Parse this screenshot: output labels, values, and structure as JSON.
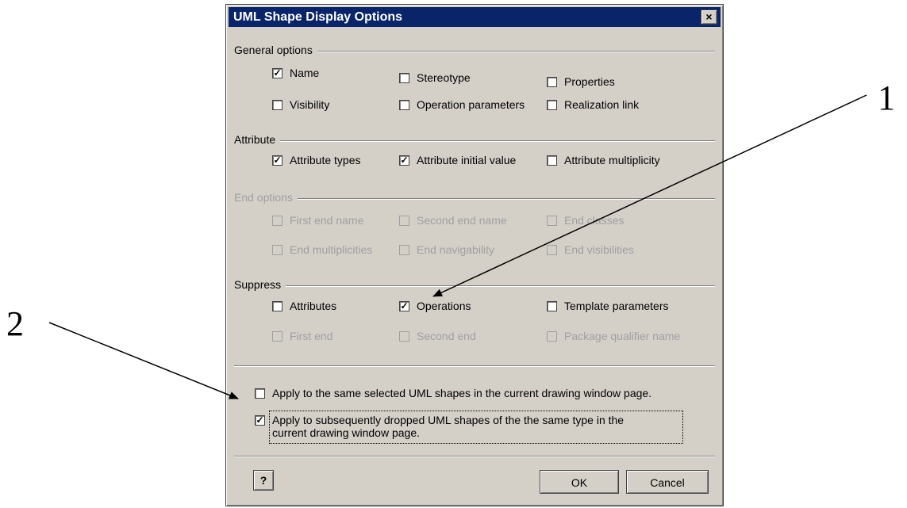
{
  "dialog": {
    "title": "UML Shape Display Options",
    "close_glyph": "×"
  },
  "general": {
    "title": "General options",
    "items": [
      {
        "label": "Name",
        "checked": true
      },
      {
        "label": "Stereotype",
        "checked": false
      },
      {
        "label": "Properties",
        "checked": false
      },
      {
        "label": "Visibility",
        "checked": false
      },
      {
        "label": "Operation parameters",
        "checked": false
      },
      {
        "label": "Realization link",
        "checked": false
      }
    ]
  },
  "attribute": {
    "title": "Attribute",
    "items": [
      {
        "label": "Attribute types",
        "checked": true
      },
      {
        "label": "Attribute initial value",
        "checked": true
      },
      {
        "label": "Attribute multiplicity",
        "checked": false
      }
    ]
  },
  "end_options": {
    "title": "End options",
    "items": [
      {
        "label": "First end name",
        "checked": false
      },
      {
        "label": "Second end name",
        "checked": false
      },
      {
        "label": "End classes",
        "checked": false
      },
      {
        "label": "End multiplicities",
        "checked": false
      },
      {
        "label": "End navigability",
        "checked": false
      },
      {
        "label": "End visibilities",
        "checked": false
      }
    ]
  },
  "suppress": {
    "title": "Suppress",
    "items": [
      {
        "label": "Attributes",
        "checked": false
      },
      {
        "label": "Operations",
        "checked": true
      },
      {
        "label": "Template parameters",
        "checked": false
      },
      {
        "label": "First end",
        "checked": false
      },
      {
        "label": "Second end",
        "checked": false
      },
      {
        "label": "Package qualifier name",
        "checked": false
      }
    ]
  },
  "apply": {
    "current": {
      "label": "Apply to the same selected UML shapes in the current drawing window page.",
      "checked": false
    },
    "subsequent": {
      "label_line1": "Apply to subsequently dropped UML shapes of the the same type in the",
      "label_line2": "current drawing window page.",
      "checked": true
    }
  },
  "buttons": {
    "help": "?",
    "ok": "OK",
    "cancel": "Cancel"
  },
  "annotations": {
    "one": "1",
    "two": "2"
  },
  "check_glyph": "✓"
}
